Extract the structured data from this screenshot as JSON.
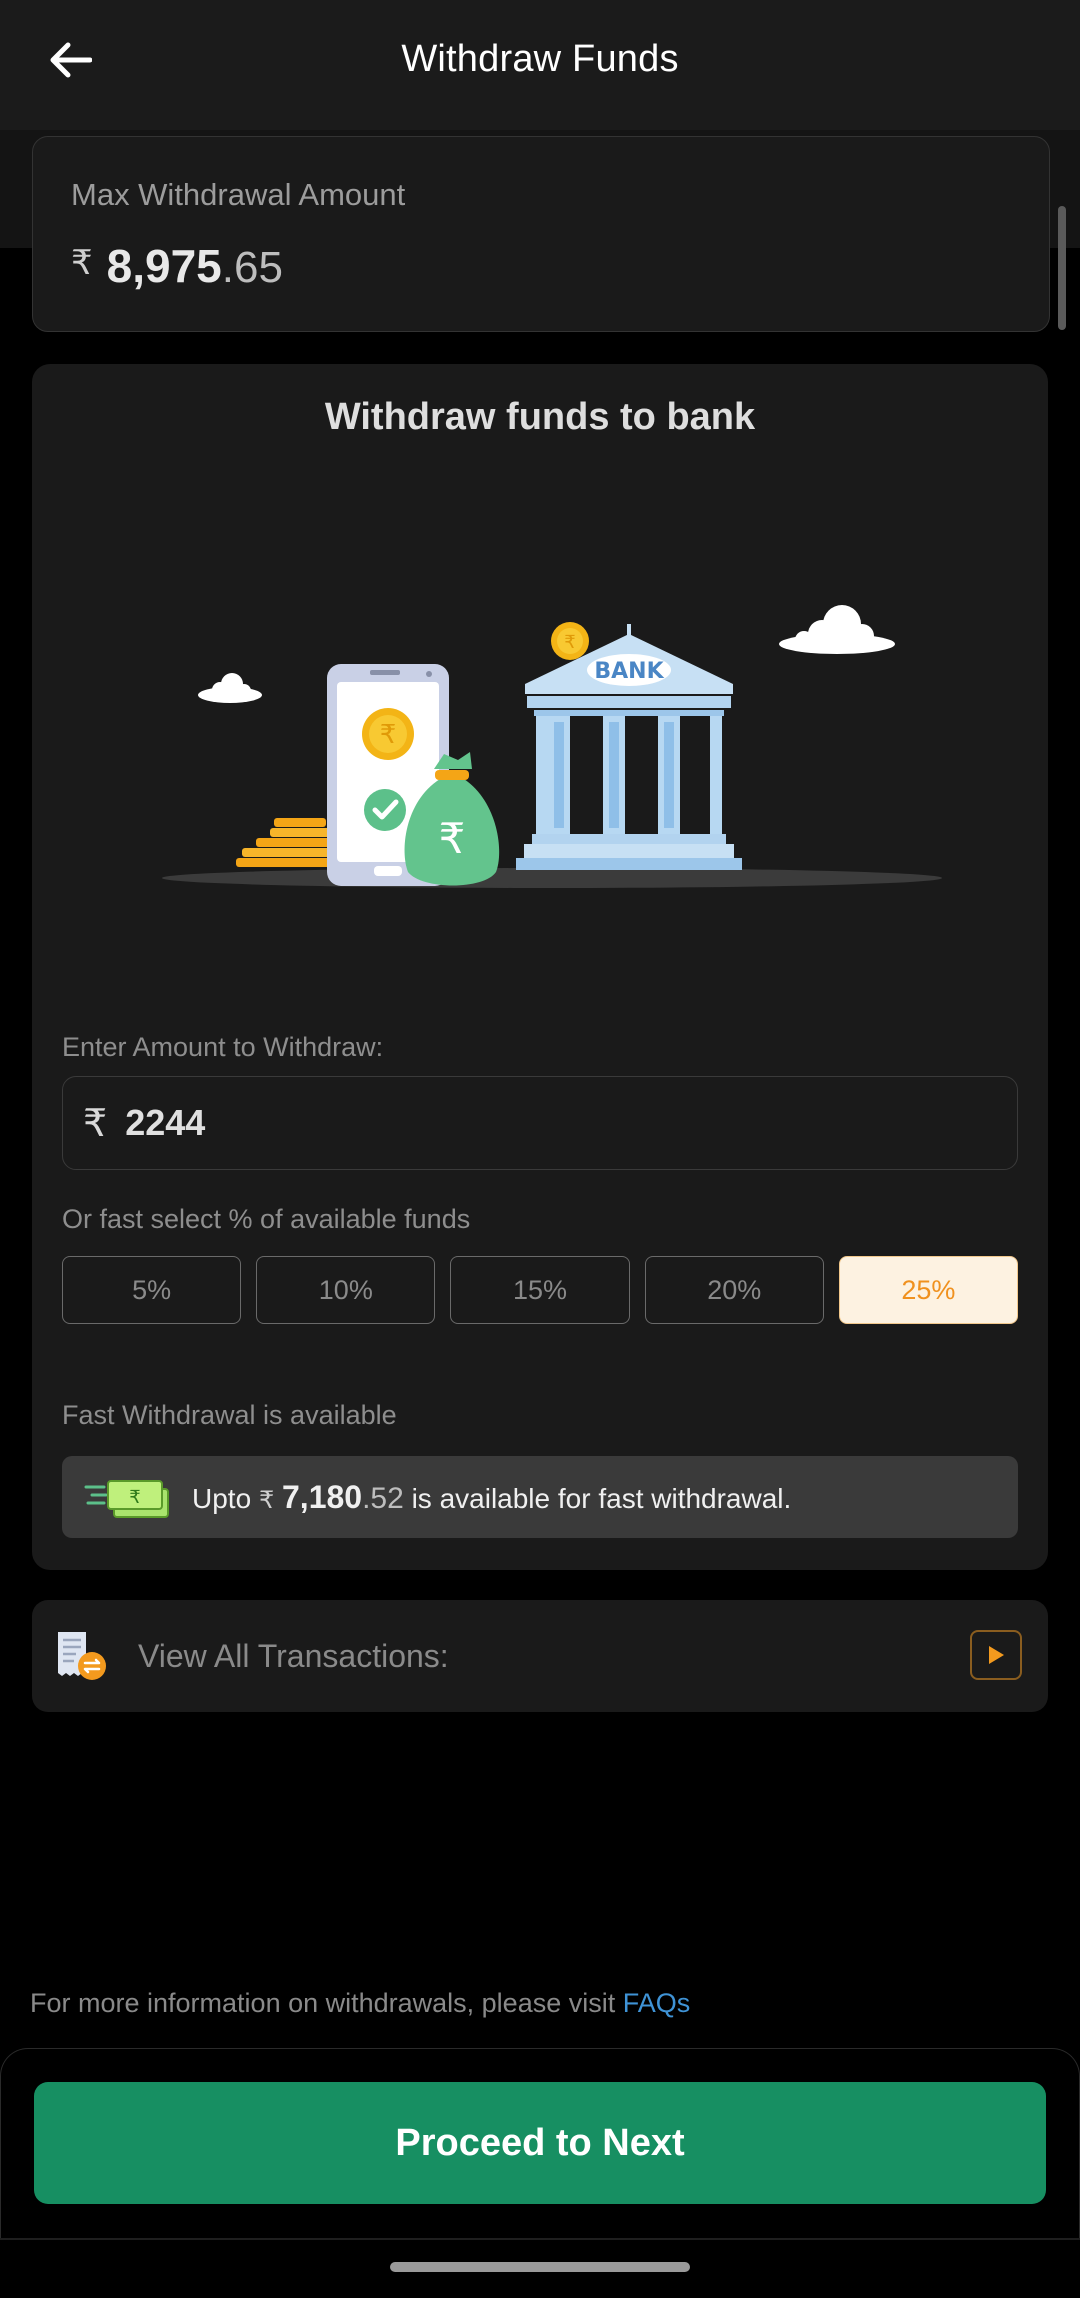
{
  "header": {
    "title": "Withdraw Funds",
    "back_icon": "arrow-left-icon"
  },
  "max_withdrawal": {
    "label": "Max Withdrawal Amount",
    "currency": "₹",
    "amount_int": "8,975",
    "amount_dec": ".65"
  },
  "main": {
    "title": "Withdraw funds to bank",
    "illustration_bank_text": "BANK",
    "enter_label": "Enter Amount to Withdraw:",
    "amount_currency": "₹",
    "amount_value": "2244",
    "fast_select_label": "Or fast select % of available funds",
    "percentages": [
      "5%",
      "10%",
      "15%",
      "20%",
      "25%"
    ],
    "selected_percentage": "25%",
    "fast_withdrawal_label": "Fast Withdrawal is available",
    "fast_withdrawal": {
      "prefix": "Upto",
      "currency": "₹",
      "amount_int": "7,180",
      "amount_dec": ".52",
      "suffix": "is available for fast withdrawal."
    }
  },
  "transactions": {
    "label": "View All Transactions:"
  },
  "footer": {
    "info_text": "For more information on withdrawals, please visit",
    "faq_link": "FAQs",
    "proceed_label": "Proceed to Next"
  },
  "colors": {
    "accent_green": "#178f62",
    "selected_orange": "#f0911e",
    "link_blue": "#3f93d6",
    "card_bg": "#1a1a1a"
  }
}
